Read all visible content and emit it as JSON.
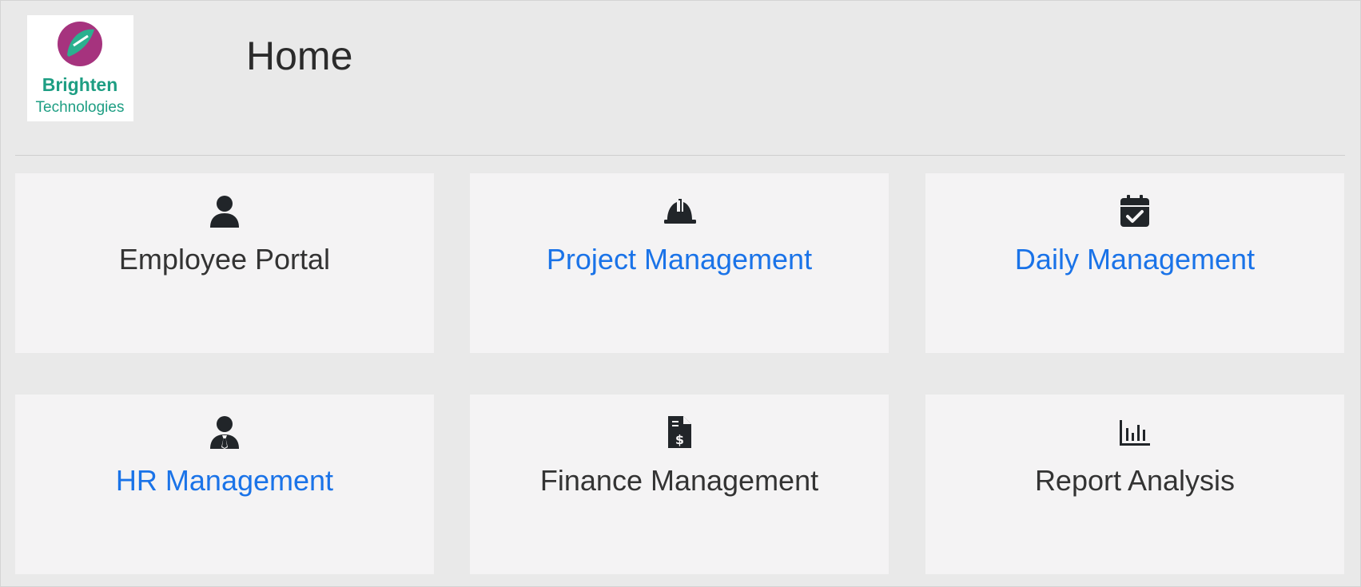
{
  "header": {
    "title": "Home",
    "logo": {
      "line1": "Brighten",
      "line2": "Technologies"
    }
  },
  "colors": {
    "background": "#e9e9e9",
    "card": "#f4f3f4",
    "link": "#1a73e8",
    "text": "#333333",
    "logo_teal": "#1e9e83",
    "logo_magenta": "#a6337e"
  },
  "modules": [
    {
      "label": "Employee Portal",
      "icon": "user-icon",
      "is_link": false
    },
    {
      "label": "Project Management",
      "icon": "hard-hat-icon",
      "is_link": true
    },
    {
      "label": "Daily Management",
      "icon": "calendar-check-icon",
      "is_link": true
    },
    {
      "label": "HR Management",
      "icon": "user-tie-icon",
      "is_link": true
    },
    {
      "label": "Finance Management",
      "icon": "file-invoice-dollar-icon",
      "is_link": false
    },
    {
      "label": "Report Analysis",
      "icon": "chart-bar-icon",
      "is_link": false
    }
  ]
}
